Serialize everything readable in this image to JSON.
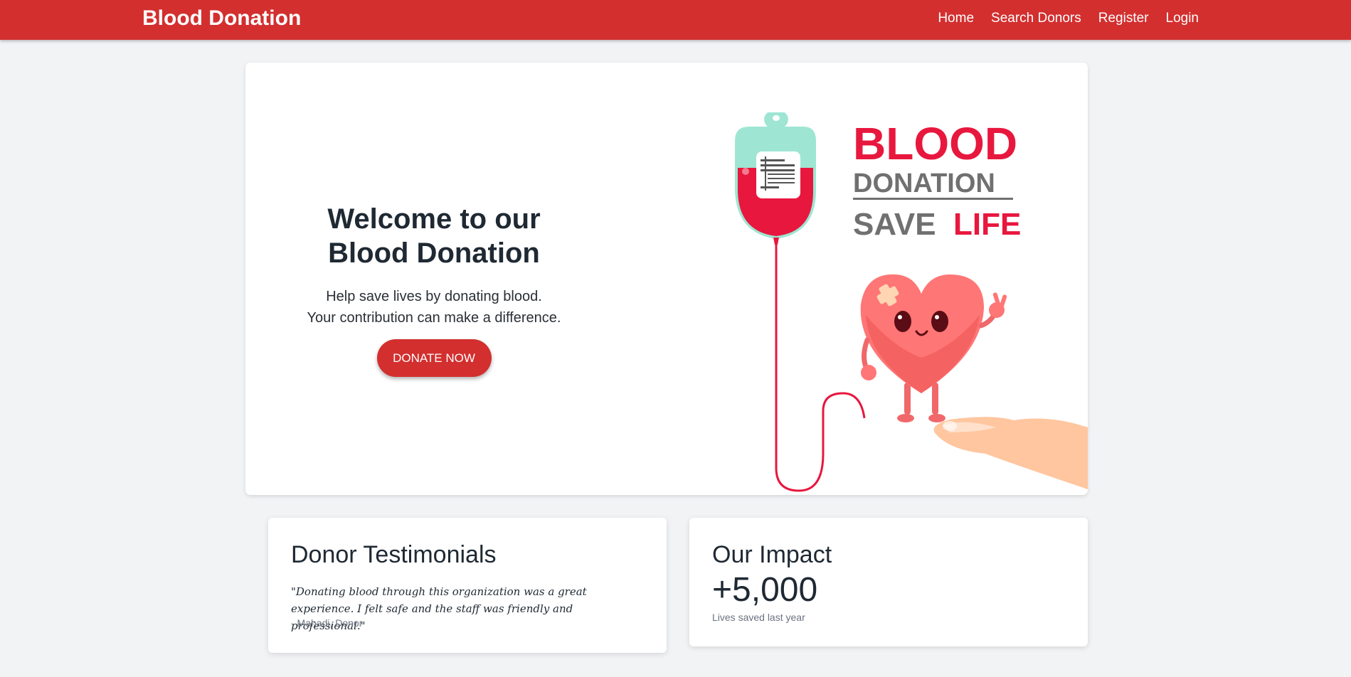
{
  "navbar": {
    "brand": "Blood Donation",
    "links": [
      "Home",
      "Search Donors",
      "Register",
      "Login"
    ],
    "color": "#d32f2f"
  },
  "hero": {
    "title_line1": "Welcome to our",
    "title_line2": "Blood Donation",
    "subtitle_line1": "Help save lives by donating blood.",
    "subtitle_line2": "Your contribution can make a difference.",
    "button_label": "DONATE NOW",
    "image": {
      "word1": "BLOOD",
      "word2": "DONATION",
      "word3a": "SAVE",
      "word3b": "LIFE"
    }
  },
  "testimonials": {
    "title": "Donor Testimonials",
    "quote": "\"Donating blood through this organization was a great experience. I felt safe and the staff was friendly and professional.\"",
    "author": "- Mahadi, Donor"
  },
  "impact": {
    "title": "Our Impact",
    "number": "+5,000",
    "label": "Lives saved last year"
  }
}
